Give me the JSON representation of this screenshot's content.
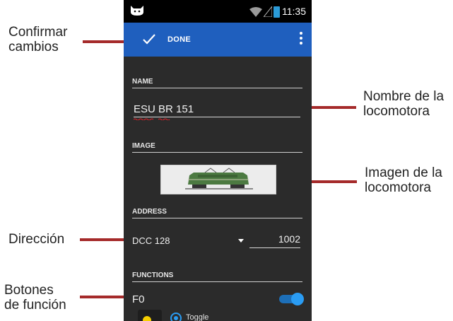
{
  "annotations": {
    "confirm": [
      "Confirmar",
      "cambios"
    ],
    "name": [
      "Nombre de la",
      "locomotora"
    ],
    "image": [
      "Imagen de la",
      "locomotora"
    ],
    "address": [
      "Dirección"
    ],
    "functions": [
      "Botones",
      "de función"
    ]
  },
  "status_bar": {
    "time": "11:35"
  },
  "action_bar": {
    "done_label": "DONE"
  },
  "sections": {
    "name_label": "NAME",
    "image_label": "IMAGE",
    "address_label": "ADDRESS",
    "functions_label": "FUNCTIONS"
  },
  "name_value": "ESU BR 151",
  "address": {
    "type": "DCC 128",
    "value": "1002"
  },
  "functions": [
    {
      "label": "F0",
      "enabled": true,
      "mode": "Toggle"
    }
  ],
  "colors": {
    "accent": "#1f5fbe",
    "annotation_line": "#a52a2a",
    "toggle_on": "#2a9cf3"
  }
}
